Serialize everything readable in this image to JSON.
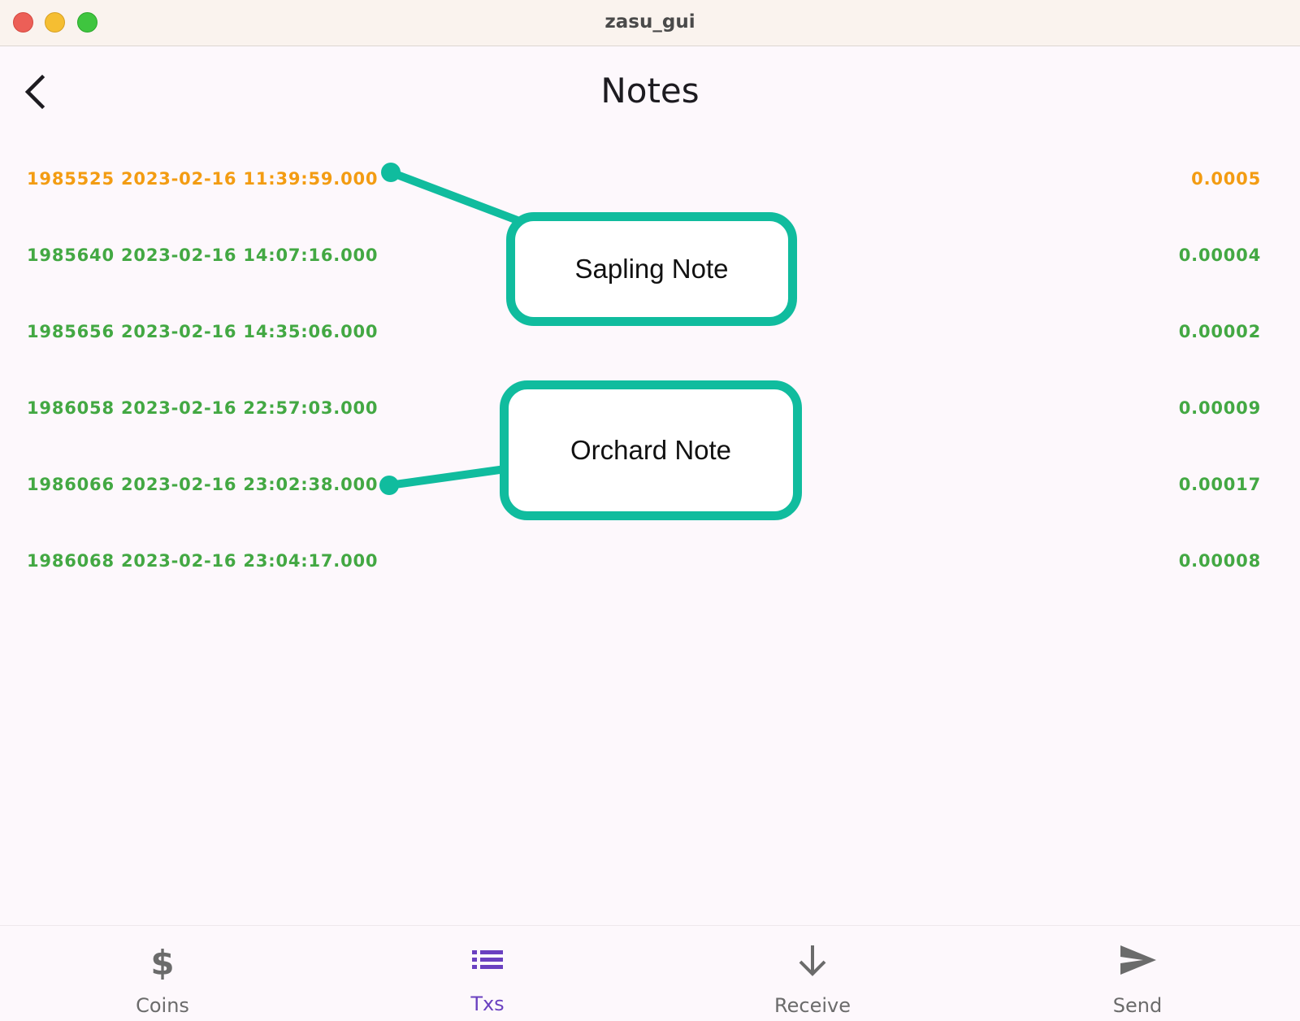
{
  "window": {
    "title": "zasu_gui"
  },
  "appbar": {
    "title": "Notes"
  },
  "colors": {
    "orange": "#f39c12",
    "green": "#43a843",
    "accent": "#6a40c0",
    "callout": "#10bc9e"
  },
  "notes": [
    {
      "height_time": "1985525 2023-02-16 11:39:59.000",
      "amount": "0.0005",
      "color": "orange"
    },
    {
      "height_time": "1985640 2023-02-16 14:07:16.000",
      "amount": "0.00004",
      "color": "green"
    },
    {
      "height_time": "1985656 2023-02-16 14:35:06.000",
      "amount": "0.00002",
      "color": "green"
    },
    {
      "height_time": "1986058 2023-02-16 22:57:03.000",
      "amount": "0.00009",
      "color": "green"
    },
    {
      "height_time": "1986066 2023-02-16 23:02:38.000",
      "amount": "0.00017",
      "color": "green"
    },
    {
      "height_time": "1986068 2023-02-16 23:04:17.000",
      "amount": "0.00008",
      "color": "green"
    }
  ],
  "callouts": {
    "sapling": "Sapling Note",
    "orchard": "Orchard Note"
  },
  "nav": {
    "items": [
      {
        "label": "Coins",
        "icon": "dollar-icon",
        "active": false
      },
      {
        "label": "Txs",
        "icon": "list-icon",
        "active": true
      },
      {
        "label": "Receive",
        "icon": "arrow-down-icon",
        "active": false
      },
      {
        "label": "Send",
        "icon": "send-icon",
        "active": false
      }
    ]
  }
}
